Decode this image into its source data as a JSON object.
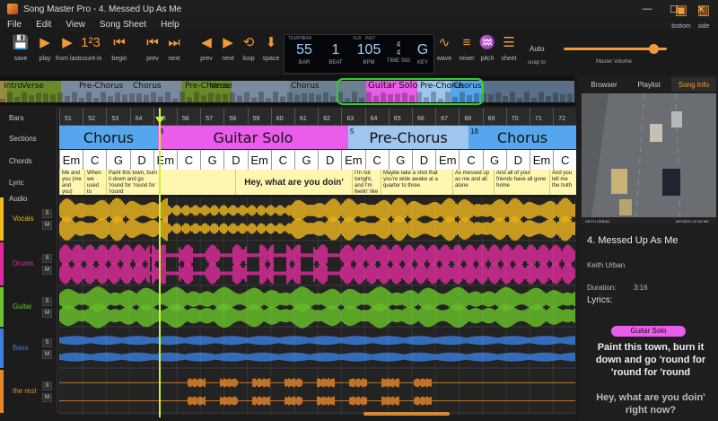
{
  "window": {
    "title": "Song Master Pro - 4. Messed Up As Me",
    "min": "—",
    "max": "☐",
    "close": "✕"
  },
  "menu": [
    "File",
    "Edit",
    "View",
    "Song Sheet",
    "Help"
  ],
  "toolbar": {
    "buttons": [
      {
        "name": "save",
        "label": "save",
        "icon": "💾"
      },
      {
        "name": "play",
        "label": "play",
        "icon": "▶"
      },
      {
        "name": "from-last",
        "label": "from last",
        "icon": "▶"
      },
      {
        "name": "count-in",
        "label": "count-in",
        "icon": "1²3"
      },
      {
        "name": "begin",
        "label": "begin",
        "icon": "⏮"
      },
      {
        "name": "prev",
        "label": "prev",
        "icon": "⏮"
      },
      {
        "name": "next",
        "label": "next",
        "icon": "⏭"
      },
      {
        "name": "prev2",
        "label": "prev",
        "icon": "◀"
      },
      {
        "name": "next2",
        "label": "next",
        "icon": "▶"
      },
      {
        "name": "loop",
        "label": "loop",
        "icon": "⟲"
      },
      {
        "name": "space",
        "label": "space",
        "icon": "⬇"
      },
      {
        "name": "wave",
        "label": "wave",
        "icon": "∿"
      },
      {
        "name": "mixer",
        "label": "mixer",
        "icon": "≡"
      },
      {
        "name": "pitch",
        "label": "pitch",
        "icon": "♒"
      },
      {
        "name": "sheet",
        "label": "sheet",
        "icon": "☰"
      }
    ],
    "snap_value": "Auto",
    "snap_label": "snap to",
    "master_volume_label": "Master Volume",
    "master_volume_level": 0.87,
    "layout_buttons": [
      {
        "label": "bottom"
      },
      {
        "label": "side"
      }
    ]
  },
  "lcd": {
    "bar_hdr": "TEMPO",
    "bar_hdr2": "BAR",
    "bar": "55",
    "bar_label": "BAR",
    "beat": "1",
    "beat_label": "BEAT",
    "bpm_hdr": "SLB",
    "bpm_hdr2": "INST",
    "bpm": "105",
    "bpm_label": "BPM",
    "timesig_top": "4",
    "timesig_bottom": "4",
    "timesig_label": "TIME SIG",
    "key": "G",
    "key_label": "KEY"
  },
  "overview_sections": [
    "Intro",
    "Verse",
    "Pre-Chorus",
    "Chorus",
    "Pre-Chorus",
    "Verse",
    "Chorus",
    "Guitar Solo",
    "Pre-Chorus",
    "Chorus"
  ],
  "track_labels": [
    "Bars",
    "Sections",
    "Chords",
    "Lyric",
    "Audio"
  ],
  "ruler": [
    "51",
    "52",
    "53",
    "54",
    "55",
    "56",
    "57",
    "58",
    "59",
    "60",
    "61",
    "62",
    "63",
    "64",
    "65",
    "66",
    "67",
    "68",
    "69",
    "70",
    "71",
    "72"
  ],
  "sections": [
    {
      "name": "Chorus",
      "num": ""
    },
    {
      "name": "Guitar Solo",
      "num": "8"
    },
    {
      "name": "Pre-Chorus",
      "num": "5"
    },
    {
      "name": "Chorus",
      "num": "18"
    }
  ],
  "chords": [
    "Em",
    "C",
    "G",
    "D",
    "Em",
    "C",
    "G",
    "D",
    "Em",
    "C",
    "G",
    "D",
    "Em",
    "C",
    "G",
    "D",
    "Em",
    "C",
    "G",
    "D",
    "Em",
    "C"
  ],
  "lyrics": [
    "Me and you (me and you)",
    "When we used to (when...",
    "Paint this town, burn it down and go 'round for 'round for 'round",
    "Hey, what are you doin' right now?",
    "I'm not tonight, and I'm feelin' like I should call you up",
    "Maybe take a shot that you're wide awake at a quarter to three",
    "As messed up as me and all alone",
    "And all of your friends have all gone home",
    "And you tell me the truth"
  ],
  "audio_tracks": [
    {
      "name": "Vocals",
      "color": "#f0b81e"
    },
    {
      "name": "Drums",
      "color": "#e02b9c"
    },
    {
      "name": "Guitar",
      "color": "#6ac42a"
    },
    {
      "name": "Bass",
      "color": "#3a7fe0"
    },
    {
      "name": "the rest",
      "color": "#e8862a"
    }
  ],
  "sm": {
    "s": "S",
    "m": "M"
  },
  "right_panel": {
    "tabs": [
      "Browser",
      "Playlist",
      "Song Info"
    ],
    "video_caption_left": "KEITH URBAN",
    "video_caption_right": "MESSED UP AS ME",
    "song_title": "4. Messed Up As Me",
    "artist": "Keith Urban",
    "duration_label": "Duration:",
    "duration": "3:16",
    "lyrics_label": "Lyrics:",
    "current_section": "Guitar Solo",
    "current_lyric": "Paint this town, burn it down and go 'round for 'round for 'round",
    "next_lyric": "Hey, what are you doin' right now?"
  },
  "colors": {
    "chorus": "#55a6ec",
    "guitar_solo": "#ea5cea",
    "pre_chorus": "#9fc6ee",
    "accent": "#f29b38",
    "playhead": "#c8f23a"
  }
}
